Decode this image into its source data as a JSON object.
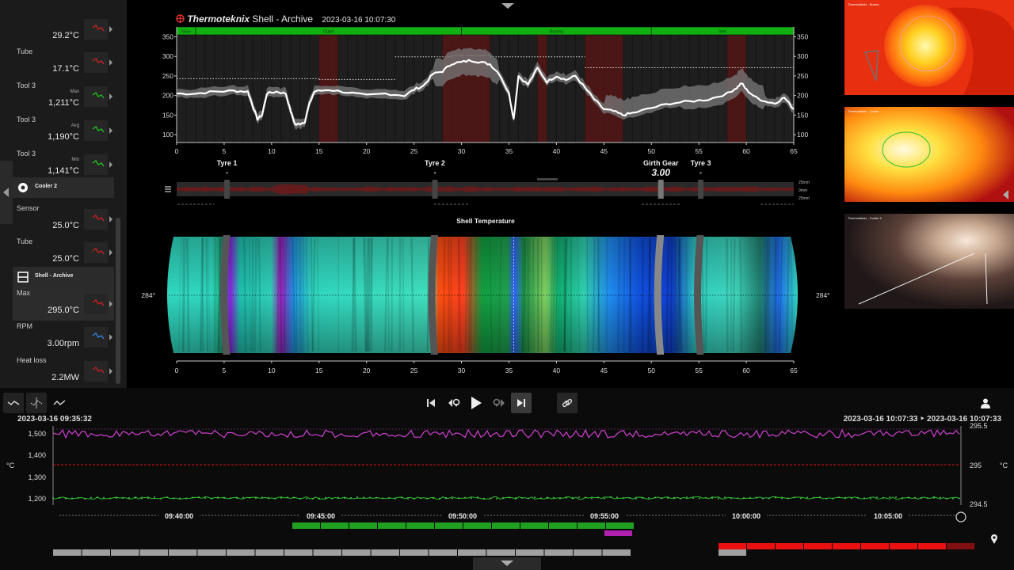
{
  "sidebar": {
    "rows": [
      {
        "label": "",
        "value": "29.2°C",
        "sub": "",
        "color": "#d02020"
      },
      {
        "label": "Tube",
        "value": "17.1°C",
        "sub": "",
        "color": "#d02020"
      },
      {
        "label": "Tool 3",
        "value": "1,211°C",
        "sub": "Max",
        "color": "#20c020"
      },
      {
        "label": "Tool 3",
        "value": "1,190°C",
        "sub": "Avg",
        "color": "#20c020"
      },
      {
        "label": "Tool 3",
        "value": "1,141°C",
        "sub": "Min",
        "color": "#20c020"
      }
    ],
    "group1": {
      "name": "Cooler 2",
      "icon": "cooler-icon"
    },
    "rows2": [
      {
        "label": "Sensor",
        "value": "25.0°C",
        "sub": "",
        "color": "#d02020"
      },
      {
        "label": "Tube",
        "value": "25.0°C",
        "sub": "",
        "color": "#d02020"
      }
    ],
    "group2": {
      "name": "Shell - Archive",
      "icon": "shell-icon"
    },
    "rows3": [
      {
        "label": "Max",
        "value": "295.0°C",
        "sub": "",
        "color": "#d02020"
      },
      {
        "label": "RPM",
        "value": "3.00rpm",
        "sub": "",
        "color": "#3080e0"
      },
      {
        "label": "Heat loss",
        "value": "2.2MW",
        "sub": "",
        "color": "#c02020"
      }
    ]
  },
  "header": {
    "brand": "Thermoteknix",
    "title": " Shell - Archive",
    "timestamp": "2023-03-16 10:07:30"
  },
  "profile_chart": {
    "zones": [
      {
        "label": "Nose",
        "from": 0,
        "to": 2
      },
      {
        "label": "Outlet",
        "from": 2,
        "to": 30
      },
      {
        "label": "Burning",
        "from": 30,
        "to": 50
      },
      {
        "label": "Inlet",
        "from": 50,
        "to": 65
      }
    ],
    "x_ticks": [
      "0",
      "5",
      "10",
      "15",
      "20",
      "25",
      "30",
      "35",
      "40",
      "45",
      "50",
      "55",
      "60",
      "65"
    ],
    "y_ticks": [
      "100",
      "150",
      "200",
      "250",
      "300",
      "350"
    ],
    "ylim": [
      80,
      355
    ],
    "xlim": [
      0,
      65
    ]
  },
  "markers": {
    "tyre1": {
      "label": "Tyre 1",
      "value": "-",
      "x": 5.3
    },
    "tyre2": {
      "label": "Tyre 2",
      "value": "-",
      "x": 27.2
    },
    "girth": {
      "label": "Girth Gear",
      "value": "3.00",
      "x": 51
    },
    "tyre3": {
      "label": "Tyre 3",
      "value": "-",
      "x": 55.2
    },
    "ovality_labels": [
      "25mm",
      "0mm",
      "25mm"
    ]
  },
  "shell_temperature": {
    "title": "Shell Temperature",
    "angle_left": "284°",
    "angle_right": "284°"
  },
  "cameras": [
    {
      "name": "Thermoteknix - Burner"
    },
    {
      "name": "Thermoteknix - Cooler"
    },
    {
      "name": "Thermoteknix - Cooler 2"
    }
  ],
  "timeline": {
    "range_start": "2023-03-16 09:35:32",
    "range_end": "2023-03-16 10:07:33 ‣ 2023-03-16 10:07:33",
    "unit_left": "°C",
    "unit_right": "°C",
    "left_ticks": [
      "1,500",
      "1,400",
      "1,300",
      "1,200"
    ],
    "right_ticks": [
      "295.5",
      "295",
      "294.5"
    ],
    "time_labels": [
      "09:40:00",
      "09:45:00",
      "09:50:00",
      "09:55:00",
      "10:00:00",
      "10:05:00"
    ]
  },
  "colors": {
    "zone_green": "#11b011",
    "series_magenta": "#d040d0",
    "series_green": "#30c030",
    "series_red": "#e01010",
    "accent": "#ffffff"
  }
}
